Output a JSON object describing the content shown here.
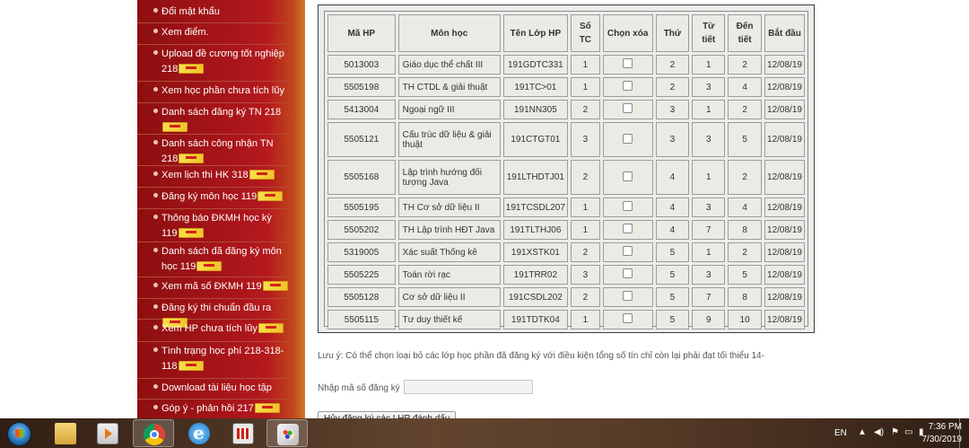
{
  "sidebar": {
    "items": [
      {
        "label": "Đổi mật khẩu",
        "new": false
      },
      {
        "label": "Xem điểm.",
        "new": false
      },
      {
        "label": "Upload đề cương tốt nghiệp 218",
        "new": true
      },
      {
        "label": "Xem học phần chưa tích lũy",
        "new": false
      },
      {
        "label": "Danh sách đăng ký TN 218",
        "new": true
      },
      {
        "label": "Danh sách công nhận TN 218",
        "new": true
      },
      {
        "label": "Xem lịch thi HK 318",
        "new": true
      },
      {
        "label": "Đăng ký môn học 119",
        "new": true
      },
      {
        "label": "Thông báo ĐKMH học kỳ 119",
        "new": true
      },
      {
        "label": "Danh sách đã đăng ký môn học 119",
        "new": true
      },
      {
        "label": "Xem mã số ĐKMH 119",
        "new": true
      },
      {
        "label": "Đăng ký thi chuẩn đầu ra",
        "new": true
      },
      {
        "label": "Xem HP chưa tích lũy",
        "new": true
      },
      {
        "label": "Tình trạng học phí 218-318-118",
        "new": true
      },
      {
        "label": "Download tài liệu học tập",
        "new": false
      },
      {
        "label": "Góp ý - phản hồi 217",
        "new": true
      }
    ]
  },
  "table": {
    "headers": [
      "Mã HP",
      "Môn học",
      "Tên Lớp HP",
      "Số TC",
      "Chọn xóa",
      "Thứ",
      "Từ tiết",
      "Đến tiết",
      "Bắt đầu"
    ],
    "rows": [
      [
        "5013003",
        "Giáo dục thể chất III",
        "191GDTC331",
        "1",
        "",
        "2",
        "1",
        "2",
        "12/08/19"
      ],
      [
        "5505198",
        "TH CTDL & giải thuật",
        "191TC>01",
        "1",
        "",
        "2",
        "3",
        "4",
        "12/08/19"
      ],
      [
        "5413004",
        "Ngoại ngữ III",
        "191NN305",
        "2",
        "",
        "3",
        "1",
        "2",
        "12/08/19"
      ],
      [
        "5505121",
        "Cấu trúc dữ liệu & giải thuật",
        "191CTGT01",
        "3",
        "",
        "3",
        "3",
        "5",
        "12/08/19"
      ],
      [
        "5505168",
        "Lập trình hướng đối tượng Java",
        "191LTHDTJ01",
        "2",
        "",
        "4",
        "1",
        "2",
        "12/08/19"
      ],
      [
        "5505195",
        "TH Cơ sở dữ liệu II",
        "191TCSDL207",
        "1",
        "",
        "4",
        "3",
        "4",
        "12/08/19"
      ],
      [
        "5505202",
        "TH Lập trình HĐT Java",
        "191TLTHJ06",
        "1",
        "",
        "4",
        "7",
        "8",
        "12/08/19"
      ],
      [
        "5319005",
        "Xác suất Thống kê",
        "191XSTK01",
        "2",
        "",
        "5",
        "1",
        "2",
        "12/08/19"
      ],
      [
        "5505225",
        "Toán rời rạc",
        "191TRR02",
        "3",
        "",
        "5",
        "3",
        "5",
        "12/08/19"
      ],
      [
        "5505128",
        "Cơ sở dữ liệu II",
        "191CSDL202",
        "2",
        "",
        "5",
        "7",
        "8",
        "12/08/19"
      ],
      [
        "5505115",
        "Tư duy thiết kế",
        "191TDTK04",
        "1",
        "",
        "5",
        "9",
        "10",
        "12/08/19"
      ]
    ]
  },
  "note": "Lưu ý: Có thể chọn loại bỏ các lớp học phần đã đăng ký với điều kiện tổng số tín chỉ còn lại phải đạt tối thiểu 14-",
  "register": {
    "label": "Nhập mã số đăng ký",
    "value": ""
  },
  "cancel_button": "Hủy đăng ký các LHP đánh dấu",
  "taskbar": {
    "icons": [
      "start-orb-icon",
      "folder-icon",
      "media-player-icon",
      "chrome-icon",
      "internet-explorer-icon",
      "app-icon",
      "paint-icon"
    ],
    "language": "EN",
    "time": "7:36 PM",
    "date": "7/30/2019"
  }
}
